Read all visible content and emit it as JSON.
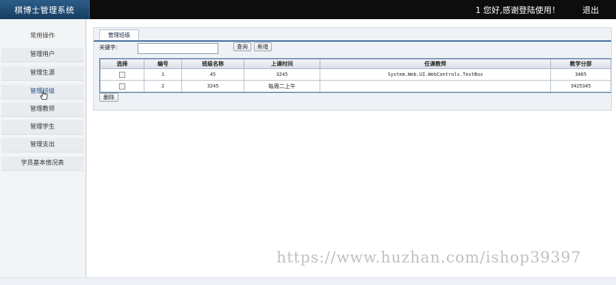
{
  "header": {
    "app_title": "棋博士管理系统",
    "greeting": "1 您好,感谢登陆使用！",
    "logout": "退出"
  },
  "sidebar": {
    "heading": "常用操作",
    "items": [
      {
        "label": "管理用户"
      },
      {
        "label": "管理生源"
      },
      {
        "label": "管理班级"
      },
      {
        "label": "管理教师"
      },
      {
        "label": "管理学生"
      },
      {
        "label": "管理支出"
      },
      {
        "label": "学员基本情况表"
      }
    ]
  },
  "main": {
    "tab_label": "管理班级",
    "search": {
      "label": "关键字:",
      "value": "",
      "query_button": "查询",
      "new_button": "新增"
    },
    "table": {
      "headers": [
        "选择",
        "编号",
        "班级名称",
        "上课时间",
        "任课教师",
        "教学分部"
      ],
      "rows": [
        {
          "id": "1",
          "name": "45",
          "time": "3245",
          "teacher": "System.Web.UI.WebControls.TextBox",
          "branch": "3465"
        },
        {
          "id": "2",
          "name": "3245",
          "time": "每周二上午",
          "teacher": "",
          "branch": "3425345"
        }
      ]
    },
    "delete_button": "删除"
  },
  "watermark": "https://www.huzhan.com/ishop39397"
}
